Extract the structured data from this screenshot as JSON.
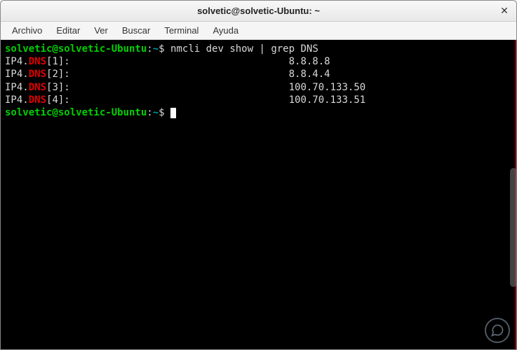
{
  "window": {
    "title": "solvetic@solvetic-Ubuntu: ~"
  },
  "menubar": {
    "items": [
      {
        "label": "Archivo"
      },
      {
        "label": "Editar"
      },
      {
        "label": "Ver"
      },
      {
        "label": "Buscar"
      },
      {
        "label": "Terminal"
      },
      {
        "label": "Ayuda"
      }
    ]
  },
  "terminal": {
    "prompt_user": "solvetic@solvetic-Ubuntu",
    "prompt_sep": ":",
    "prompt_path": "~",
    "prompt_end": "$ ",
    "command": "nmcli dev show | grep DNS",
    "entries": [
      {
        "prefix": "IP4.",
        "hl": "DNS",
        "idx": "[1]:",
        "value": "8.8.8.8"
      },
      {
        "prefix": "IP4.",
        "hl": "DNS",
        "idx": "[2]:",
        "value": "8.8.4.4"
      },
      {
        "prefix": "IP4.",
        "hl": "DNS",
        "idx": "[3]:",
        "value": "100.70.133.50"
      },
      {
        "prefix": "IP4.",
        "hl": "DNS",
        "idx": "[4]:",
        "value": "100.70.133.51"
      }
    ]
  }
}
